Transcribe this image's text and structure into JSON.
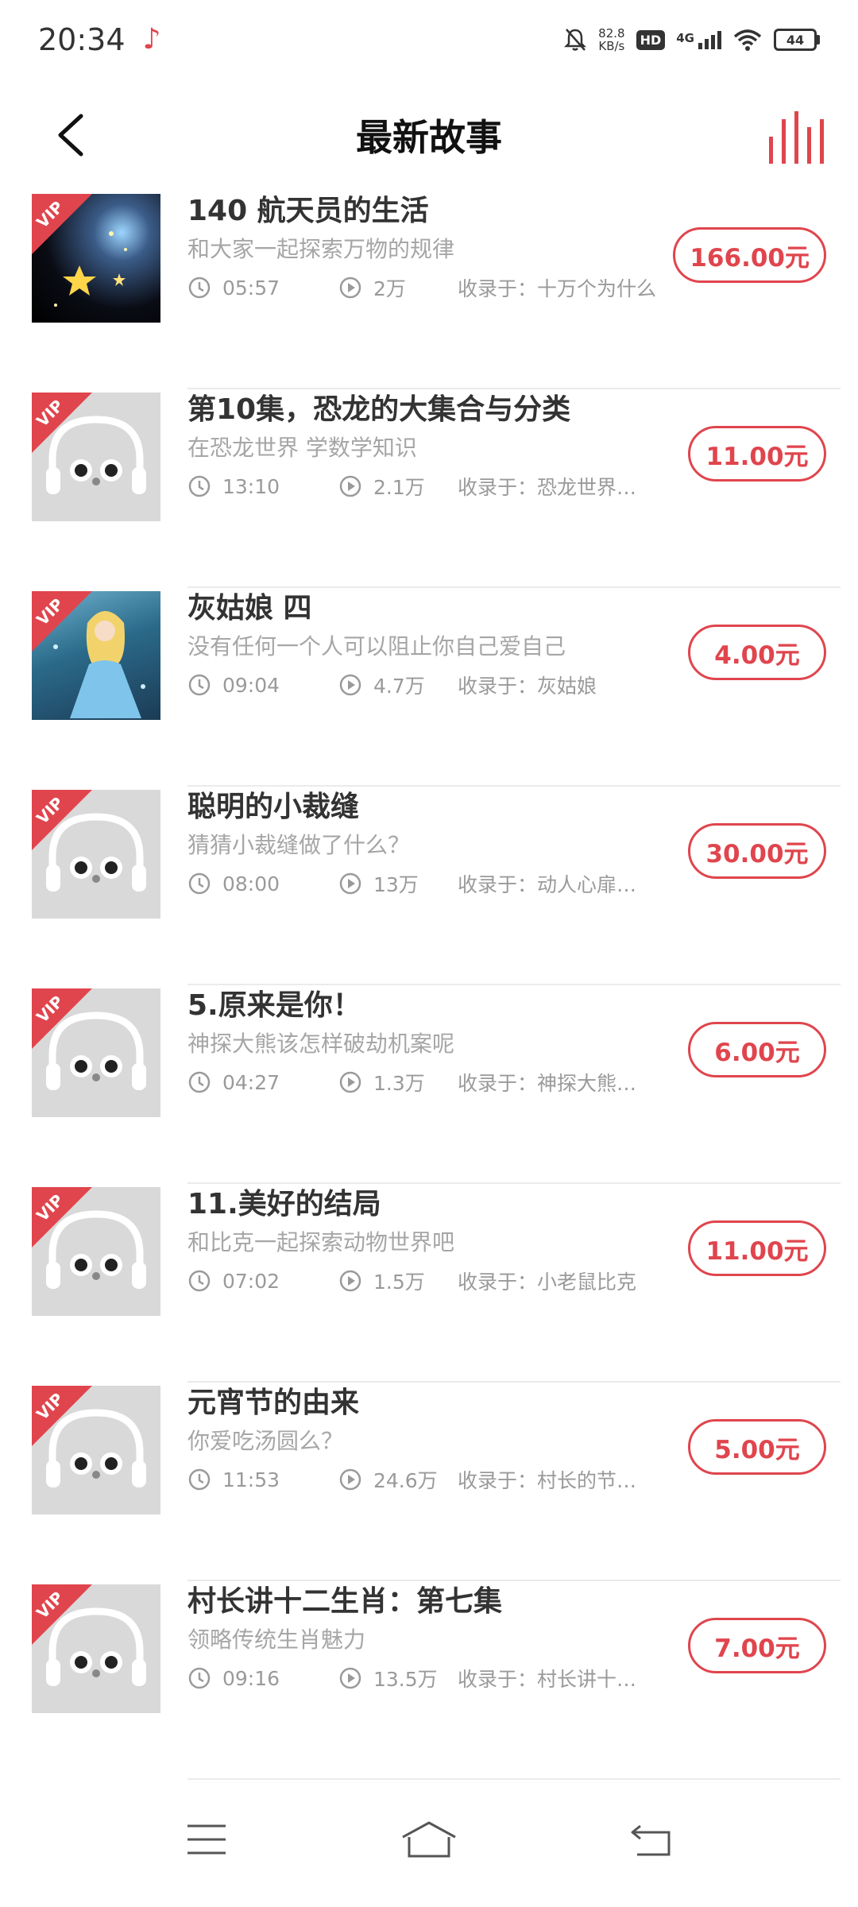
{
  "status": {
    "time": "20:34",
    "net_speed_value": "82.8",
    "net_speed_unit": "KB/s",
    "hd_label": "HD",
    "network_label": "4G",
    "battery": "44"
  },
  "header": {
    "title": "最新故事"
  },
  "colors": {
    "accent": "#e0454d",
    "title_text": "#333333",
    "secondary_text": "#a6a6a6"
  },
  "items": [
    {
      "vip": "VIP",
      "title": "140 航天员的生活",
      "subtitle": "和大家一起探索万物的规律",
      "duration": "05:57",
      "plays": "2万",
      "collection": "收录于：十万个为什么",
      "price": "166.00元",
      "cover": "space-scene"
    },
    {
      "vip": "VIP",
      "title": "第10集，恐龙的大集合与分类",
      "subtitle": "在恐龙世界 学数学知识",
      "duration": "13:10",
      "plays": "2.1万",
      "collection": "收录于：恐龙世界…",
      "price": "11.00元",
      "cover": "headphone-placeholder"
    },
    {
      "vip": "VIP",
      "title": "灰姑娘 四",
      "subtitle": "没有任何一个人可以阻止你自己爱自己",
      "duration": "09:04",
      "plays": "4.7万",
      "collection": "收录于：灰姑娘",
      "price": "4.00元",
      "cover": "princess-scene"
    },
    {
      "vip": "VIP",
      "title": "聪明的小裁缝",
      "subtitle": "猜猜小裁缝做了什么？",
      "duration": "08:00",
      "plays": "13万",
      "collection": "收录于：动人心扉…",
      "price": "30.00元",
      "cover": "headphone-placeholder"
    },
    {
      "vip": "VIP",
      "title": "5.原来是你！",
      "subtitle": "神探大熊该怎样破劫机案呢",
      "duration": "04:27",
      "plays": "1.3万",
      "collection": "收录于：神探大熊…",
      "price": "6.00元",
      "cover": "headphone-placeholder"
    },
    {
      "vip": "VIP",
      "title": "11.美好的结局",
      "subtitle": "和比克一起探索动物世界吧",
      "duration": "07:02",
      "plays": "1.5万",
      "collection": "收录于：小老鼠比克",
      "price": "11.00元",
      "cover": "headphone-placeholder"
    },
    {
      "vip": "VIP",
      "title": "元宵节的由来",
      "subtitle": "你爱吃汤圆么？",
      "duration": "11:53",
      "plays": "24.6万",
      "collection": "收录于：村长的节…",
      "price": "5.00元",
      "cover": "headphone-placeholder"
    },
    {
      "vip": "VIP",
      "title": "村长讲十二生肖：第七集",
      "subtitle": "领略传统生肖魅力",
      "duration": "09:16",
      "plays": "13.5万",
      "collection": "收录于：村长讲十…",
      "price": "7.00元",
      "cover": "headphone-placeholder"
    }
  ],
  "nav": {
    "menu_icon": "menu-icon",
    "home_icon": "home-icon",
    "back_icon": "return-icon"
  }
}
